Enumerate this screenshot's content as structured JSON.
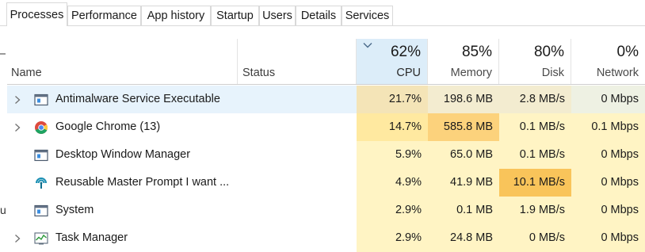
{
  "tabs": [
    {
      "label": "Processes",
      "active": true
    },
    {
      "label": "Performance"
    },
    {
      "label": "App history"
    },
    {
      "label": "Startup"
    },
    {
      "label": "Users"
    },
    {
      "label": "Details"
    },
    {
      "label": "Services"
    }
  ],
  "header": {
    "name": "Name",
    "status": "Status",
    "sort_icon": "chevron-down-icon",
    "cpu": {
      "pct": "62%",
      "label": "CPU"
    },
    "memory": {
      "pct": "85%",
      "label": "Memory"
    },
    "disk": {
      "pct": "80%",
      "label": "Disk"
    },
    "network": {
      "pct": "0%",
      "label": "Network"
    }
  },
  "left_edge_glyph": "u",
  "colors": {
    "selected_row": "#e7f3fc",
    "cpu_header": "#dcedf9",
    "heat_none": "#eef1e3",
    "heat_low": "#fff4c4",
    "heat_mid": "#ffe9a0",
    "heat_high": "#fcd27c",
    "heat_max": "#f9c45a"
  },
  "processes": [
    {
      "name": "Antimalware Service Executable",
      "icon": "app-window-icon",
      "expandable": true,
      "selected": true,
      "cpu": "21.7%",
      "memory": "198.6 MB",
      "disk": "2.8 MB/s",
      "network": "0 Mbps",
      "heat": {
        "cpu": "#f4e4b7",
        "memory": "#f3ecd0",
        "disk": "#f3ecd0",
        "network": "#eef1e3"
      }
    },
    {
      "name": "Google Chrome (13)",
      "icon": "chrome-icon",
      "expandable": true,
      "selected": false,
      "cpu": "14.7%",
      "memory": "585.8 MB",
      "disk": "0.1 MB/s",
      "network": "0.1 Mbps",
      "heat": {
        "cpu": "#ffe9a0",
        "memory": "#fcd27c",
        "disk": "#fff4c4",
        "network": "#fff4c4"
      }
    },
    {
      "name": "Desktop Window Manager",
      "icon": "app-window-icon",
      "expandable": false,
      "selected": false,
      "cpu": "5.9%",
      "memory": "65.0 MB",
      "disk": "0.1 MB/s",
      "network": "0 Mbps",
      "heat": {
        "cpu": "#fff4c4",
        "memory": "#fff4c4",
        "disk": "#fff4c4",
        "network": "#fff4c4"
      }
    },
    {
      "name": "Reusable Master Prompt I want ...",
      "icon": "signal-icon",
      "expandable": false,
      "selected": false,
      "cpu": "4.9%",
      "memory": "41.9 MB",
      "disk": "10.1 MB/s",
      "network": "0 Mbps",
      "heat": {
        "cpu": "#fff4c4",
        "memory": "#fff4c4",
        "disk": "#f9c45a",
        "network": "#fff4c4"
      }
    },
    {
      "name": "System",
      "icon": "app-window-icon",
      "expandable": false,
      "selected": false,
      "cpu": "2.9%",
      "memory": "0.1 MB",
      "disk": "1.9 MB/s",
      "network": "0 Mbps",
      "heat": {
        "cpu": "#fff4c4",
        "memory": "#fff4c4",
        "disk": "#fff4c4",
        "network": "#fff4c4"
      }
    },
    {
      "name": "Task Manager",
      "icon": "task-manager-icon",
      "expandable": true,
      "selected": false,
      "cpu": "2.9%",
      "memory": "24.8 MB",
      "disk": "0 MB/s",
      "network": "0 Mbps",
      "heat": {
        "cpu": "#fff4c4",
        "memory": "#fff4c4",
        "disk": "#fff4c4",
        "network": "#fff4c4"
      }
    }
  ]
}
